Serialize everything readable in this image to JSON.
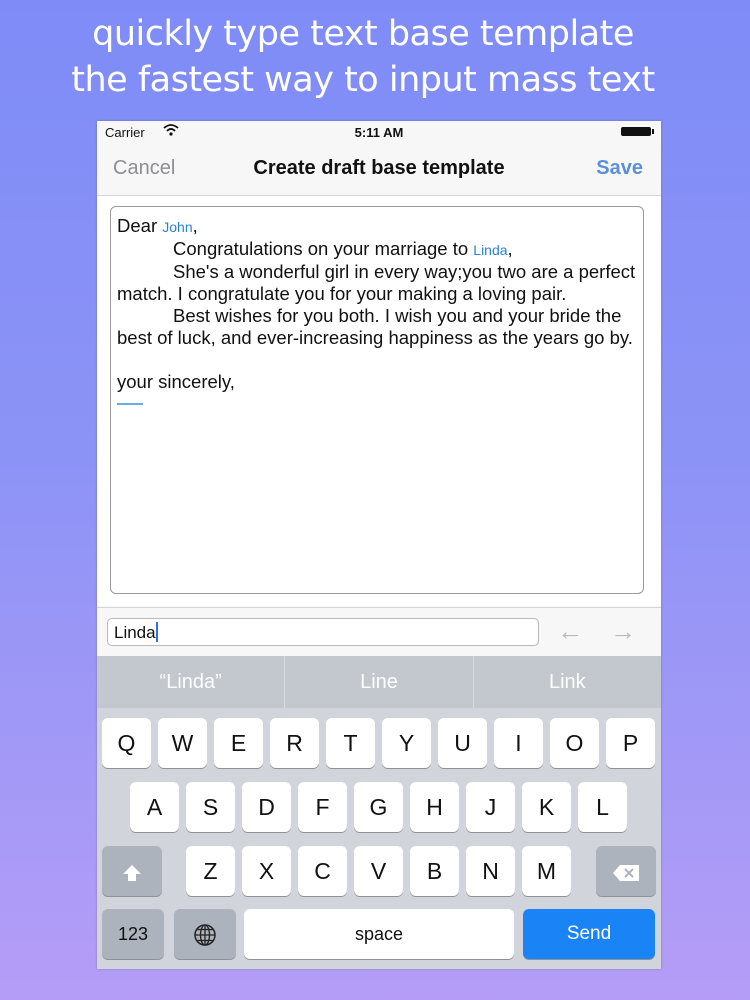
{
  "promo": {
    "line1": "quickly type text base  template",
    "line2": "the fastest way to input mass text"
  },
  "status_bar": {
    "carrier": "Carrier",
    "time": "5:11 AM",
    "wifi_icon": "wifi-icon",
    "battery_icon": "battery-icon"
  },
  "nav": {
    "cancel": "Cancel",
    "title": "Create draft base template",
    "save": "Save"
  },
  "editor": {
    "dear": "Dear",
    "name_token": "John",
    "comma": ",",
    "congrats": "Congratulations on your marriage to",
    "partner_token": "Linda",
    "line2": "She's a wonderful girl in every way;you two are a perfect match. I congratulate you for your making a loving pair.",
    "line3": "Best wishes for you both. I wish you and your bride the best of luck, and ever-increasing happiness as the years go by.",
    "signoff": "your sincerely,"
  },
  "find": {
    "value": "Linda",
    "prev_icon": "arrow-left-icon",
    "next_icon": "arrow-right-icon"
  },
  "suggestions": [
    "“Linda”",
    "Line",
    "Link"
  ],
  "keyboard": {
    "row1": [
      "Q",
      "W",
      "E",
      "R",
      "T",
      "Y",
      "U",
      "I",
      "O",
      "P"
    ],
    "row2": [
      "A",
      "S",
      "D",
      "F",
      "G",
      "H",
      "J",
      "K",
      "L"
    ],
    "row3": [
      "Z",
      "X",
      "C",
      "V",
      "B",
      "N",
      "M"
    ],
    "numbers": "123",
    "space": "space",
    "send": "Send",
    "shift_icon": "shift-icon",
    "delete_icon": "delete-icon",
    "globe_icon": "globe-icon"
  },
  "colors": {
    "accent": "#1a84f7",
    "save": "#5b8fd8",
    "token": "#2b7fd9"
  }
}
